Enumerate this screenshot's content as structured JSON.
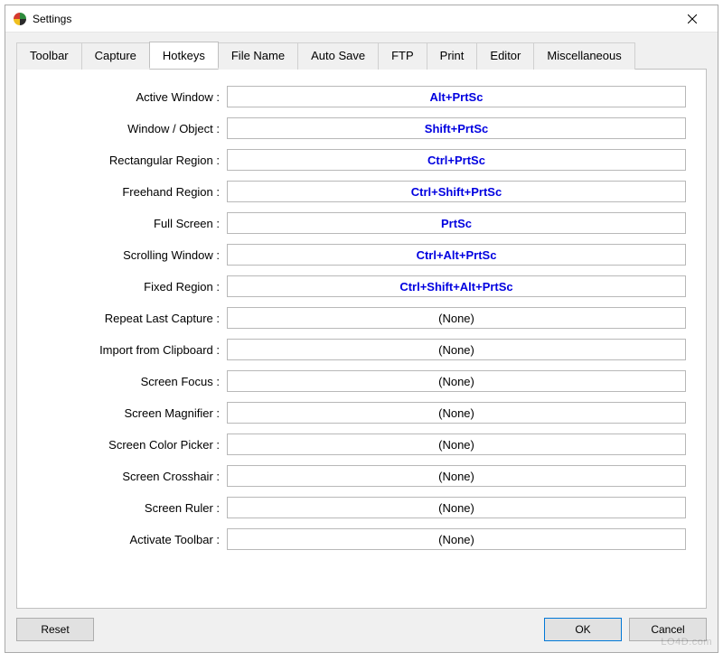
{
  "window": {
    "title": "Settings"
  },
  "tabs": [
    {
      "label": "Toolbar"
    },
    {
      "label": "Capture"
    },
    {
      "label": "Hotkeys"
    },
    {
      "label": "File Name"
    },
    {
      "label": "Auto Save"
    },
    {
      "label": "FTP"
    },
    {
      "label": "Print"
    },
    {
      "label": "Editor"
    },
    {
      "label": "Miscellaneous"
    }
  ],
  "activeTab": "Hotkeys",
  "hotkeys": [
    {
      "label": "Active Window :",
      "value": "Alt+PrtSc",
      "set": true
    },
    {
      "label": "Window / Object :",
      "value": "Shift+PrtSc",
      "set": true
    },
    {
      "label": "Rectangular Region :",
      "value": "Ctrl+PrtSc",
      "set": true
    },
    {
      "label": "Freehand Region :",
      "value": "Ctrl+Shift+PrtSc",
      "set": true
    },
    {
      "label": "Full Screen :",
      "value": "PrtSc",
      "set": true
    },
    {
      "label": "Scrolling Window :",
      "value": "Ctrl+Alt+PrtSc",
      "set": true
    },
    {
      "label": "Fixed Region :",
      "value": "Ctrl+Shift+Alt+PrtSc",
      "set": true
    },
    {
      "label": "Repeat Last Capture :",
      "value": "(None)",
      "set": false
    },
    {
      "label": "Import from Clipboard :",
      "value": "(None)",
      "set": false
    },
    {
      "label": "Screen Focus :",
      "value": "(None)",
      "set": false
    },
    {
      "label": "Screen Magnifier :",
      "value": "(None)",
      "set": false
    },
    {
      "label": "Screen Color Picker :",
      "value": "(None)",
      "set": false
    },
    {
      "label": "Screen Crosshair :",
      "value": "(None)",
      "set": false
    },
    {
      "label": "Screen Ruler :",
      "value": "(None)",
      "set": false
    },
    {
      "label": "Activate Toolbar :",
      "value": "(None)",
      "set": false
    }
  ],
  "buttons": {
    "reset": "Reset",
    "ok": "OK",
    "cancel": "Cancel"
  },
  "watermark": "LO4D.com"
}
